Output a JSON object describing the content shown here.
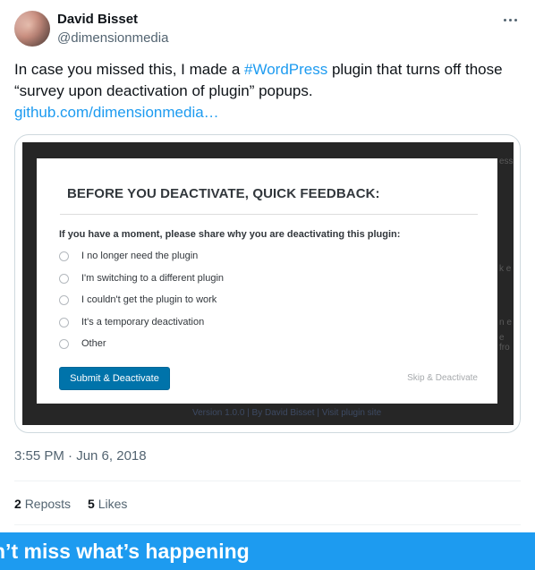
{
  "author": {
    "name": "David Bisset",
    "handle": "@dimensionmedia"
  },
  "tweet": {
    "text_before": "In case you missed this, I made a ",
    "hashtag": "#WordPress",
    "text_after": " plugin that turns off those “survey upon deactivation of plugin” popups.",
    "link": "github.com/dimensionmedia…"
  },
  "media": {
    "background_fragments": [
      "ess",
      "k e",
      "n e",
      "e fro"
    ],
    "background_footer": "Version 1.0.0 | By David Bisset | Visit plugin site",
    "dialog": {
      "title": "BEFORE YOU DEACTIVATE, QUICK FEEDBACK:",
      "question": "If you have a moment, please share why you are deactivating this plugin:",
      "options": [
        "I no longer need the plugin",
        "I'm switching to a different plugin",
        "I couldn't get the plugin to work",
        "It's a temporary deactivation",
        "Other"
      ],
      "submit_label": "Submit & Deactivate",
      "skip_label": "Skip & Deactivate"
    }
  },
  "timestamp": "3:55 PM · Jun 6, 2018",
  "stats": {
    "reposts_count": "2",
    "reposts_label": "Reposts",
    "likes_count": "5",
    "likes_label": "Likes"
  },
  "banner": {
    "text": "n’t miss what’s happening"
  },
  "colors": {
    "accent": "#1d9bf0",
    "wp_button": "#0073aa"
  }
}
